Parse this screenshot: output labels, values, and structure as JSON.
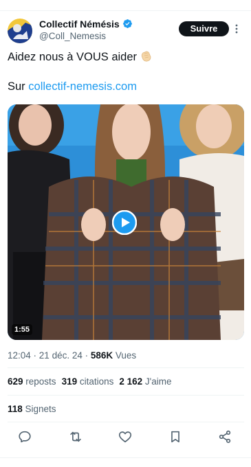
{
  "author": {
    "name": "Collectif Némésis",
    "handle": "@Coll_Nemesis",
    "verified": true,
    "avatar_icon": "nemesis-logo-icon"
  },
  "follow_label": "Suivre",
  "tweet": {
    "text": "Aidez nous à VOUS aider",
    "emoji": "clapping-hands-icon",
    "link_prefix": "Sur ",
    "link_text": "collectif-nemesis.com"
  },
  "media": {
    "type": "video",
    "duration": "1:55"
  },
  "meta": {
    "time": "12:04",
    "dot1": " · ",
    "date": "21 déc. 24",
    "dot2": " · ",
    "views_count": "586K",
    "views_label": " Vues"
  },
  "stats": {
    "reposts_count": "629",
    "reposts_label": " reposts",
    "citations_count": "319",
    "citations_label": " citations",
    "likes_count": "2 162",
    "likes_label": " J'aime",
    "bookmarks_count": "118",
    "bookmarks_label": " Signets"
  },
  "actions": [
    "reply-icon",
    "repost-icon",
    "like-icon",
    "bookmark-icon",
    "share-icon"
  ],
  "colors": {
    "accent": "#1d9bf0",
    "text": "#0f1419",
    "secondary": "#536471"
  }
}
